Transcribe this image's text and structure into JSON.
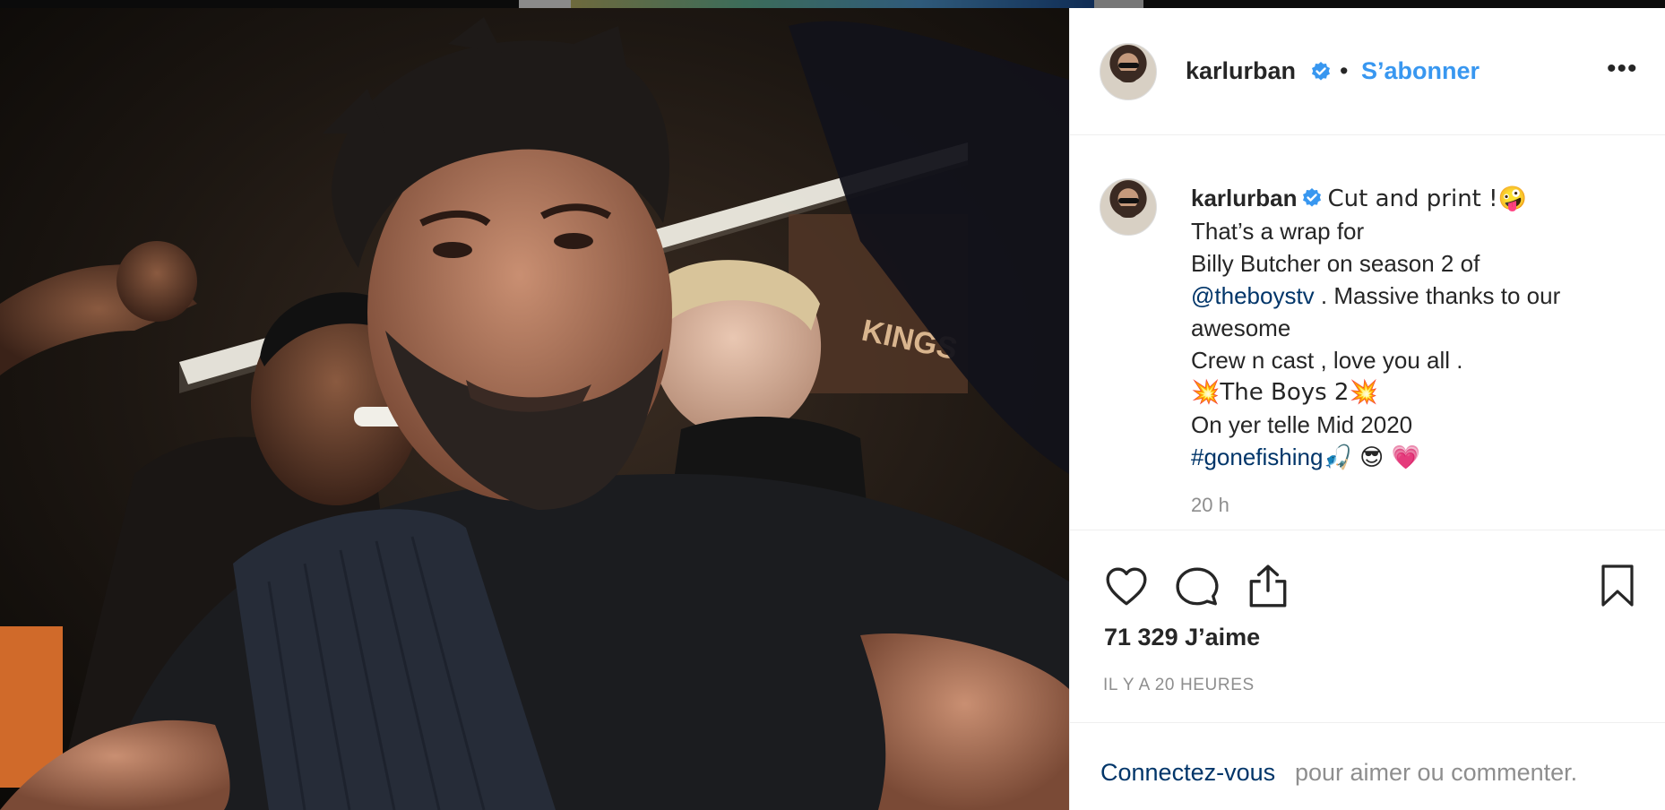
{
  "post": {
    "username": "karlurban",
    "follow_label": "S’abonner",
    "separator": "•",
    "more_label": "•••",
    "caption": {
      "username": "karlurban",
      "lines": [
        "Cut and print !🤪",
        "That’s a wrap for",
        "Billy Butcher on season 2 of",
        ". Massive thanks to our",
        "awesome",
        "Crew n cast , love you all .",
        "💥The Boys 2💥",
        "On yer telle Mid 2020",
        "🎣 😎 💗"
      ],
      "mention": "@theboystv",
      "hashtag": "#gonefishing"
    },
    "caption_time": "20 h",
    "likes": "71 329 J’aime",
    "post_time": "IL Y A 20 HEURES",
    "footer": {
      "login_link": "Connectez-vous",
      "login_rest": "pour aimer ou commenter."
    }
  },
  "colors": {
    "link_blue": "#3897f0",
    "hashtag_blue": "#003569",
    "text": "#262626",
    "muted": "#8e8e8e",
    "verified": "#3897f0"
  },
  "icons": {
    "like": "heart-icon",
    "comment": "comment-icon",
    "share": "share-icon",
    "save": "bookmark-icon",
    "verified": "verified-badge-icon",
    "more": "more-options-icon"
  }
}
